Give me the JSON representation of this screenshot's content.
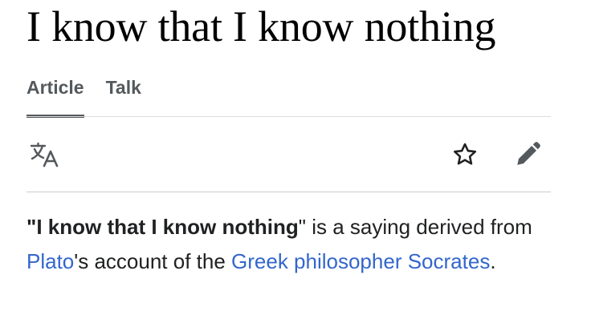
{
  "header": {
    "title": "I know that I know nothing"
  },
  "tabs": [
    {
      "label": "Article",
      "selected": true
    },
    {
      "label": "Talk",
      "selected": false
    }
  ],
  "toolbar": {
    "icons": [
      "language-icon",
      "star-icon",
      "pencil-icon"
    ]
  },
  "article": {
    "quote_open": "\"",
    "bold_phrase": "I know that I know nothing",
    "quote_close": "\"",
    "text_1": " is a saying derived from ",
    "link_plato": "Plato",
    "text_2": "'s account of the ",
    "link_greek_philosopher": "Greek philosopher",
    "text_3": " ",
    "link_socrates": "Socrates",
    "text_4": "."
  },
  "colors": {
    "link": "#3366cc",
    "text": "#202122",
    "icon": "#54595d",
    "divider": "#c8ccd1"
  }
}
